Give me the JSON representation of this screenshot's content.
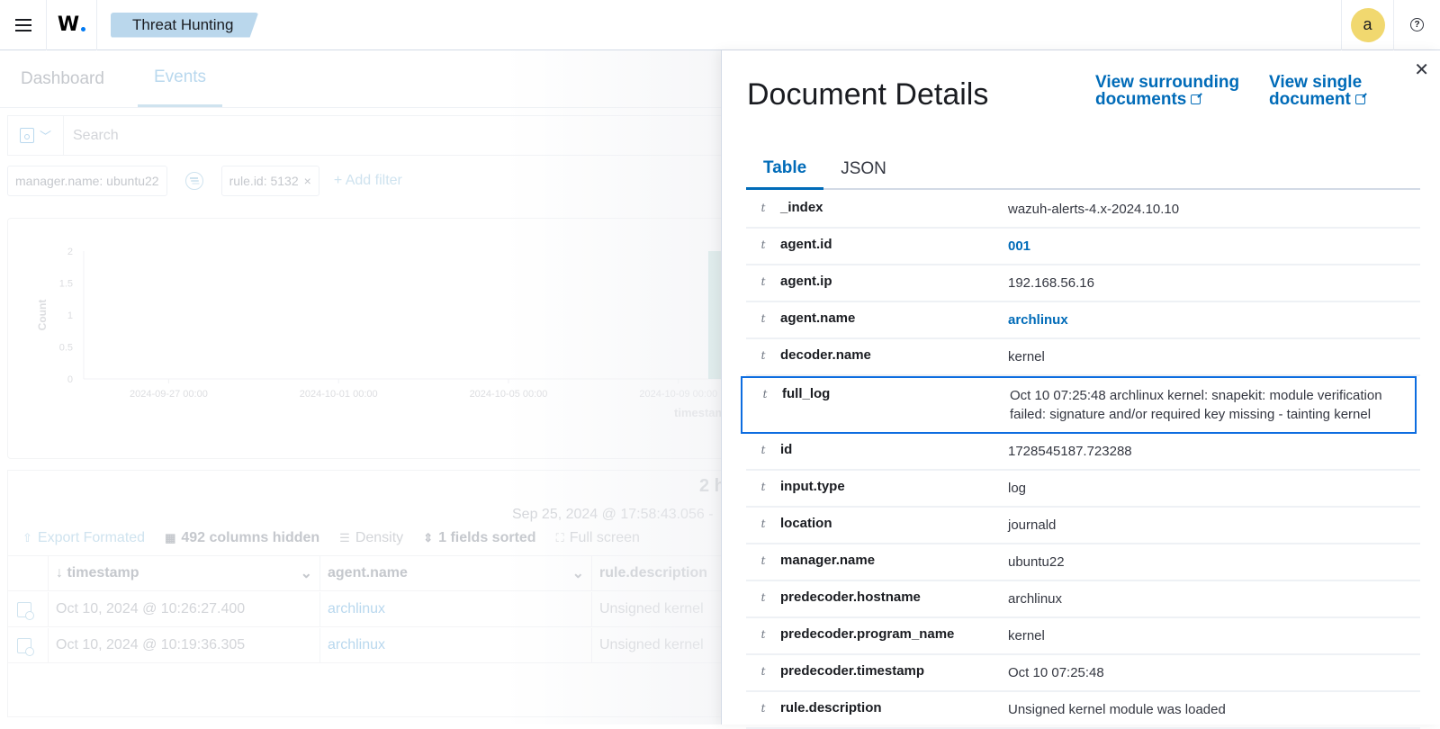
{
  "header": {
    "menu_icon": "hamburger-icon",
    "logo_text": "W",
    "breadcrumb": "Threat Hunting",
    "avatar_letter": "a",
    "help_icon": "question-circle-icon",
    "help_symbol": "?"
  },
  "tabs": [
    {
      "label": "Dashboard",
      "active": false
    },
    {
      "label": "Events",
      "active": true
    }
  ],
  "search": {
    "placeholder": "Search",
    "value": ""
  },
  "filters": {
    "pills": [
      {
        "label": "manager.name: ubuntu22",
        "removable": false
      },
      {
        "label": "rule.id: 5132",
        "removable": true
      }
    ],
    "remove_symbol": "×",
    "add_filter_label": "+ Add filter"
  },
  "chart_data": {
    "type": "bar",
    "title": "",
    "xlabel": "timestamp",
    "ylabel": "Count",
    "ylim": [
      0,
      2
    ],
    "y_ticks": [
      "0",
      "0.5",
      "1",
      "1.5",
      "2"
    ],
    "x_ticks": [
      "2024-09-27 00:00",
      "2024-10-01 00:00",
      "2024-10-05 00:00",
      "2024-10-09 00:00"
    ],
    "x_range": [
      "2024-09-25",
      "2024-10-10"
    ],
    "bars": [
      {
        "x": "2024-10-10",
        "value": 2
      }
    ],
    "bar_color": "#a7d3cf"
  },
  "results": {
    "hits_text": "2 h",
    "date_range": "Sep 25, 2024 @ 17:58:43.056 -",
    "toolbar": {
      "export": "Export Formated",
      "columns_hidden": "492 columns hidden",
      "density": "Density",
      "sorted": "1 fields sorted",
      "full_screen": "Full screen"
    },
    "columns": [
      "timestamp",
      "agent.name",
      "rule.description"
    ],
    "sort_arrow": "↓",
    "rows": [
      {
        "timestamp": "Oct 10, 2024 @ 10:26:27.400",
        "agent": "archlinux",
        "description": "Unsigned kernel"
      },
      {
        "timestamp": "Oct 10, 2024 @ 10:19:36.305",
        "agent": "archlinux",
        "description": "Unsigned kernel"
      }
    ]
  },
  "flyout": {
    "title": "Document Details",
    "link_surrounding_line1": "View surrounding",
    "link_surrounding_line2": "documents",
    "link_single_line1": "View single",
    "link_single_line2": "document",
    "close_symbol": "✕",
    "tabs": [
      {
        "label": "Table",
        "active": true
      },
      {
        "label": "JSON",
        "active": false
      }
    ],
    "type_glyph": "t",
    "fields": [
      {
        "name": "_index",
        "value": "wazuh-alerts-4.x-2024.10.10",
        "link": false
      },
      {
        "name": "agent.id",
        "value": "001",
        "link": true
      },
      {
        "name": "agent.ip",
        "value": "192.168.56.16",
        "link": false
      },
      {
        "name": "agent.name",
        "value": "archlinux",
        "link": true
      },
      {
        "name": "decoder.name",
        "value": "kernel",
        "link": false
      },
      {
        "name": "full_log",
        "value": "Oct 10 07:25:48 archlinux kernel: snapekit: module verification failed: signature and/or required key missing - tainting kernel",
        "link": false,
        "highlighted": true
      },
      {
        "name": "id",
        "value": "1728545187.723288",
        "link": false
      },
      {
        "name": "input.type",
        "value": "log",
        "link": false
      },
      {
        "name": "location",
        "value": "journald",
        "link": false
      },
      {
        "name": "manager.name",
        "value": "ubuntu22",
        "link": false
      },
      {
        "name": "predecoder.hostname",
        "value": "archlinux",
        "link": false
      },
      {
        "name": "predecoder.program_name",
        "value": "kernel",
        "link": false
      },
      {
        "name": "predecoder.timestamp",
        "value": "Oct 10 07:25:48",
        "link": false
      },
      {
        "name": "rule.description",
        "value": "Unsigned kernel module was loaded",
        "link": false
      }
    ]
  }
}
